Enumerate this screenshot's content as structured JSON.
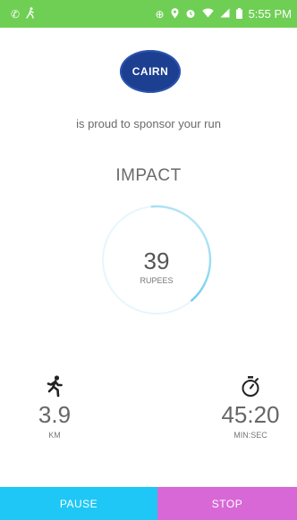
{
  "status_bar": {
    "time": "5:55 PM",
    "left_icons": [
      "phone-icon",
      "running-icon"
    ],
    "right_icons": [
      "add-circle-icon",
      "location-icon",
      "alarm-icon",
      "wifi-icon",
      "signal-icon",
      "battery-icon"
    ]
  },
  "logo": {
    "text": "CAIRN",
    "color": "#1d3f91"
  },
  "sponsor_text": "is proud to sponsor your run",
  "impact": {
    "heading": "IMPACT",
    "value": "39",
    "unit": "RUPEES",
    "progress": 0.39
  },
  "distance": {
    "icon": "runner-icon",
    "value": "3.9",
    "unit": "KM"
  },
  "duration": {
    "icon": "stopwatch-icon",
    "value": "45:20",
    "unit": "MIN:SEC"
  },
  "buttons": {
    "pause_label": "PAUSE",
    "stop_label": "STOP",
    "pause_color": "#1ec7f5",
    "stop_color": "#d768d6"
  },
  "colors": {
    "status_bar": "#6fcf54",
    "ring": "#29b6e6"
  }
}
